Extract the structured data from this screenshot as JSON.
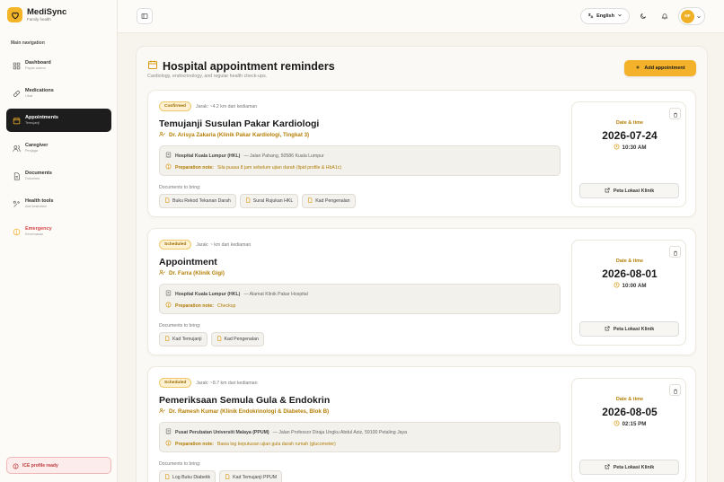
{
  "brand": {
    "name": "MediSync",
    "subtitle": "Family health"
  },
  "sidebar": {
    "section_label": "Main navigation",
    "items": [
      {
        "label": "Dashboard",
        "sub": "Papan utama",
        "icon": "dashboard-icon"
      },
      {
        "label": "Medications",
        "sub": "Ubat",
        "icon": "pill-icon"
      },
      {
        "label": "Appointments",
        "sub": "Temujanji",
        "icon": "calendar-icon"
      },
      {
        "label": "Caregiver",
        "sub": "Penjaga",
        "icon": "users-icon"
      },
      {
        "label": "Documents",
        "sub": "Dokumen",
        "icon": "document-icon"
      },
      {
        "label": "Health tools",
        "sub": "Alat kesihatan",
        "icon": "tools-icon"
      },
      {
        "label": "Emergency",
        "sub": "Kecemasan",
        "icon": "alert-icon"
      }
    ],
    "ice_status": "ICE profile ready"
  },
  "header": {
    "language": "English",
    "avatar_initials": "NF"
  },
  "page": {
    "title": "Hospital appointment reminders",
    "subtitle": "Cardiology, endocrinology, and regular health check-ups.",
    "add_button": "Add appointment"
  },
  "labels": {
    "documents_to_bring": "Documents to bring:",
    "preparation_note": "Preparation note:",
    "date_time": "Date & time",
    "map_button": "Peta Lokasi Klinik"
  },
  "appointments": [
    {
      "status": "Confirmed",
      "distance": "Jarak: ~4.2 km dari kediaman",
      "title": "Temujanji Susulan Pakar Kardiologi",
      "doctor": "Dr. Arisya Zakaria (Klinik Pakar Kardiologi, Tingkat 3)",
      "hospital": "Hospital Kuala Lumpur (HKL)",
      "address": "— Jalan Pahang, 50586 Kuala Lumpur",
      "prep_note": "Sila puasa 8 jam sebelum ujian darah (lipid profile & HbA1c)",
      "documents": [
        "Buku Rekod Tekanan Darah",
        "Surat Rujukan HKL",
        "Kad Pengenalan"
      ],
      "date": "2026-07-24",
      "time": "10:30 AM"
    },
    {
      "status": "Scheduled",
      "distance": "Jarak: ~ km dari kediaman",
      "title": "Appointment",
      "doctor": "Dr. Farra (Klinik Gigi)",
      "hospital": "Hospital Kuala Lumpur (HKL)",
      "address": "— Alamat Klinik Pakar Hospital",
      "prep_note": "Checkup",
      "documents": [
        "Kad Temujanji",
        "Kad Pengenalan"
      ],
      "date": "2026-08-01",
      "time": "10:00 AM"
    },
    {
      "status": "Scheduled",
      "distance": "Jarak: ~8.7 km dari kediaman",
      "title": "Pemeriksaan Semula Gula & Endokrin",
      "doctor": "Dr. Ramesh Kumar (Klinik Endokrinologi & Diabetes, Blok B)",
      "hospital": "Pusat Perubatan Universiti Malaya (PPUM)",
      "address": "— Jalan Professor Diraja Ungku Abdul Aziz, 59100 Petaling Jaya",
      "prep_note": "Bawa log keputusan ujian gula darah rumah (glucometer)",
      "documents": [
        "Log Buku Diabetik",
        "Kad Temujanji PPUM"
      ],
      "date": "2026-08-05",
      "time": "02:15 PM"
    }
  ]
}
